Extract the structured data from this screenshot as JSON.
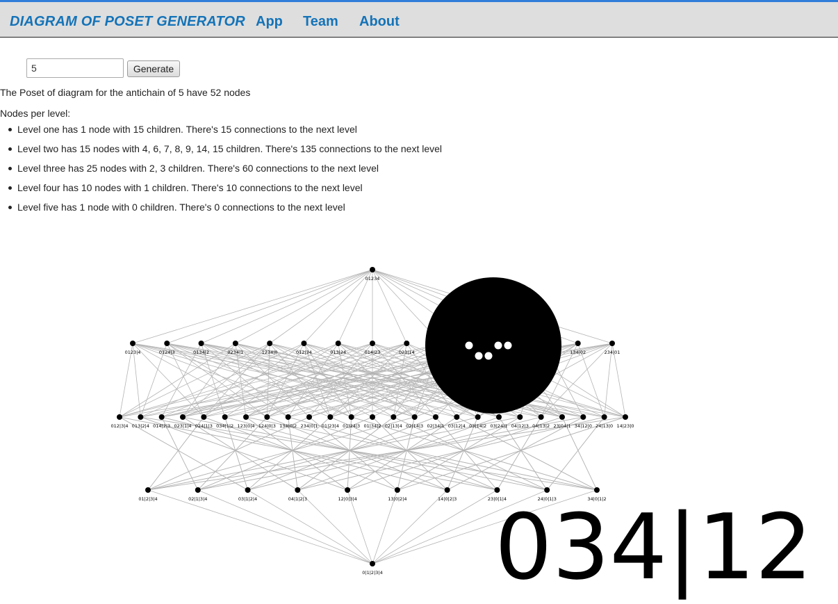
{
  "nav": {
    "brand": "DIAGRAM OF POSET GENERATOR",
    "app": "App",
    "team": "Team",
    "about": "About"
  },
  "form": {
    "input_value": "5",
    "generate_label": "Generate"
  },
  "summary": "The Poset of diagram for the antichain of 5 have 52 nodes",
  "levels_title": "Nodes per level:",
  "levels": [
    "Level one has 1 node with 15 children. There's 15 connections to the next level",
    "Level two has 15 nodes with 4, 6, 7, 8, 9, 14, 15 children. There's 135 connections to the next level",
    "Level three has 25 nodes with 2, 3 children. There's 60 connections to the next level",
    "Level four has 10 nodes with 1 children. There's 10 connections to the next level",
    "Level five has 1 node with 0 children. There's 0 connections to the next level"
  ],
  "graph": {
    "levels": [
      [
        "01234"
      ],
      [
        "0123|4",
        "0124|3",
        "0134|2",
        "0234|1",
        "1234|0",
        "012|34",
        "013|24",
        "014|23",
        "023|14",
        "",
        "",
        "",
        "",
        "134|02",
        "234|01"
      ],
      [
        "012|3|4",
        "013|2|4",
        "014|2|3",
        "023|1|4",
        "024|1|3",
        "034|1|2",
        "123|0|4",
        "124|0|3",
        "134|0|2",
        "234|0|1",
        "01|23|4",
        "01|24|3",
        "01|34|2",
        "02|13|4",
        "02|14|3",
        "02|34|1",
        "03|12|4",
        "03|14|2",
        "03|24|1",
        "04|12|3",
        "04|13|2",
        "23|04|1",
        "34|12|0",
        "24|13|0",
        "14|23|0"
      ],
      [
        "01|2|3|4",
        "02|1|3|4",
        "03|1|2|4",
        "04|1|2|3",
        "12|0|3|4",
        "13|0|2|4",
        "14|0|2|3",
        "23|0|1|4",
        "24|0|1|3",
        "34|0|1|2"
      ],
      [
        "0|1|2|3|4"
      ]
    ],
    "hovered_node": "034|12",
    "edge_color": "#b4b4b4",
    "node_color": "#000000"
  }
}
